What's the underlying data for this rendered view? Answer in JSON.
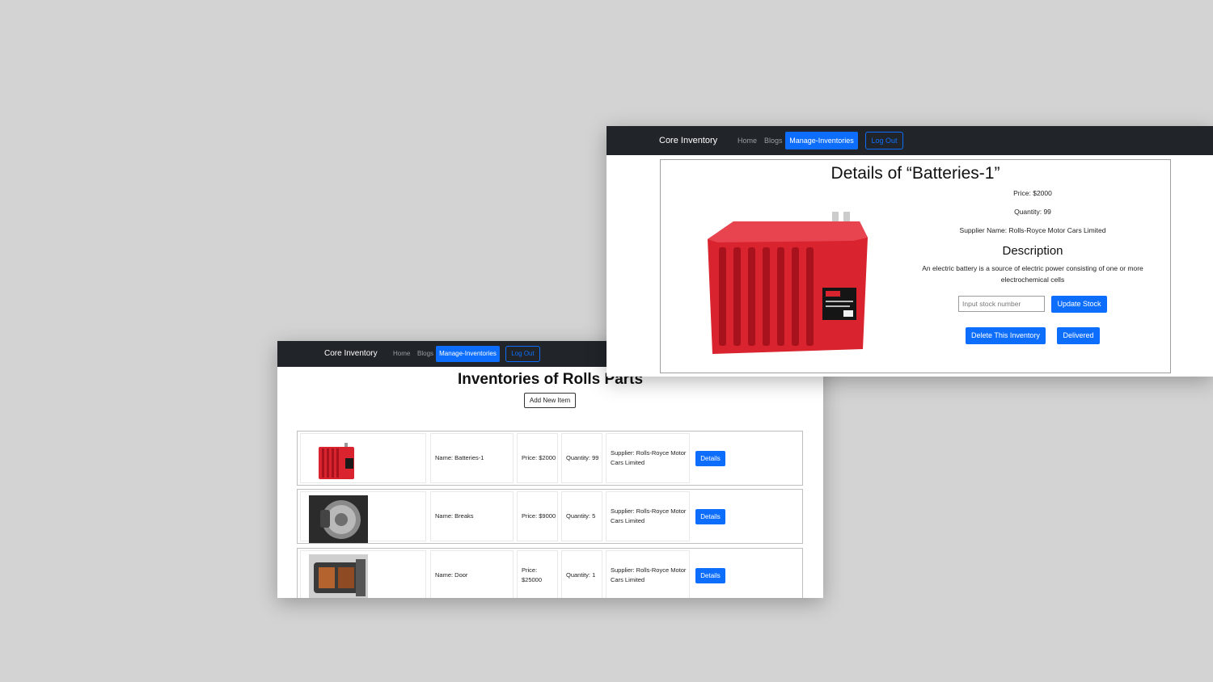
{
  "list_page": {
    "brand": "Core Inventory",
    "nav": {
      "home": "Home",
      "blogs": "Blogs",
      "manage": "Manage-Inventories",
      "logout": "Log Out"
    },
    "title": "Inventories of Rolls Parts",
    "add_button": "Add New Item",
    "items": [
      {
        "name": "Name: Batteries-1",
        "price": "Price: $2000",
        "quantity": "Quantity: 99",
        "supplier": "Supplier: Rolls-Royce Motor Cars Limited",
        "button": "Details",
        "thumb": "battery-thumbnail"
      },
      {
        "name": "Name: Breaks",
        "price": "Price: $9000",
        "quantity": "Quantity: 5",
        "supplier": "Supplier: Rolls-Royce Motor Cars Limited",
        "button": "Details",
        "thumb": "brake-thumbnail"
      },
      {
        "name": "Name: Door",
        "price": "Price: $25000",
        "quantity": "Quantity: 1",
        "supplier": "Supplier: Rolls-Royce Motor Cars Limited",
        "button": "Details",
        "thumb": "door-thumbnail"
      }
    ]
  },
  "detail_page": {
    "brand": "Core Inventory",
    "nav": {
      "home": "Home",
      "blogs": "Blogs",
      "manage": "Manage-Inventories",
      "logout": "Log Out"
    },
    "title": "Details of “Batteries-1”",
    "price": "Price: $2000",
    "quantity": "Quantity: 99",
    "supplier": "Supplier Name: Rolls-Royce Motor Cars Limited",
    "description_heading": "Description",
    "description": "An electric battery is a source of electric power consisting of one or more electrochemical cells",
    "stock_placeholder": "Input stock number",
    "update_button": "Update Stock",
    "delete_button": "Delete This Inventory",
    "delivered_button": "Delivered",
    "image": "battery-image"
  },
  "colors": {
    "background": "#d3d3d3",
    "navbar": "#212529",
    "primary": "#0d6efd",
    "battery_red": "#d9232e"
  }
}
